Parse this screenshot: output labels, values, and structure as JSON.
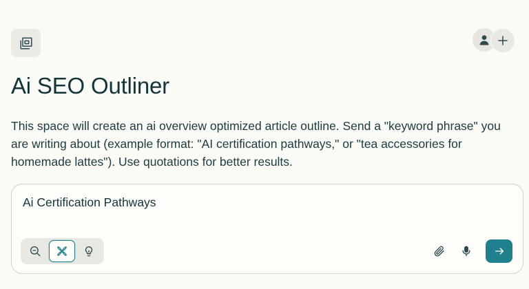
{
  "header": {
    "space_icon": "space-icon",
    "avatar_icon": "user-icon",
    "add_icon": "plus-icon"
  },
  "space": {
    "title": "Ai SEO Outliner",
    "description": "This space will create an ai overview optimized article outline. Send a \"keyword phrase\" you are writing about (example format: \"AI certification pathways,\" or \"tea accessories for homemade lattes\"). Use quotations for better results."
  },
  "composer": {
    "input_value": "Ai Certification Pathways",
    "modes": [
      {
        "icon": "search-icon",
        "selected": false
      },
      {
        "icon": "research-icon",
        "selected": true
      },
      {
        "icon": "lightbulb-icon",
        "selected": false
      }
    ],
    "tools": {
      "attach_icon": "paperclip-icon",
      "mic_icon": "microphone-icon",
      "submit_icon": "arrow-right-icon"
    }
  },
  "colors": {
    "background": "#fbfbf6",
    "text": "#13343b",
    "accent": "#20808d",
    "chip_bg": "#e9e9e3"
  }
}
